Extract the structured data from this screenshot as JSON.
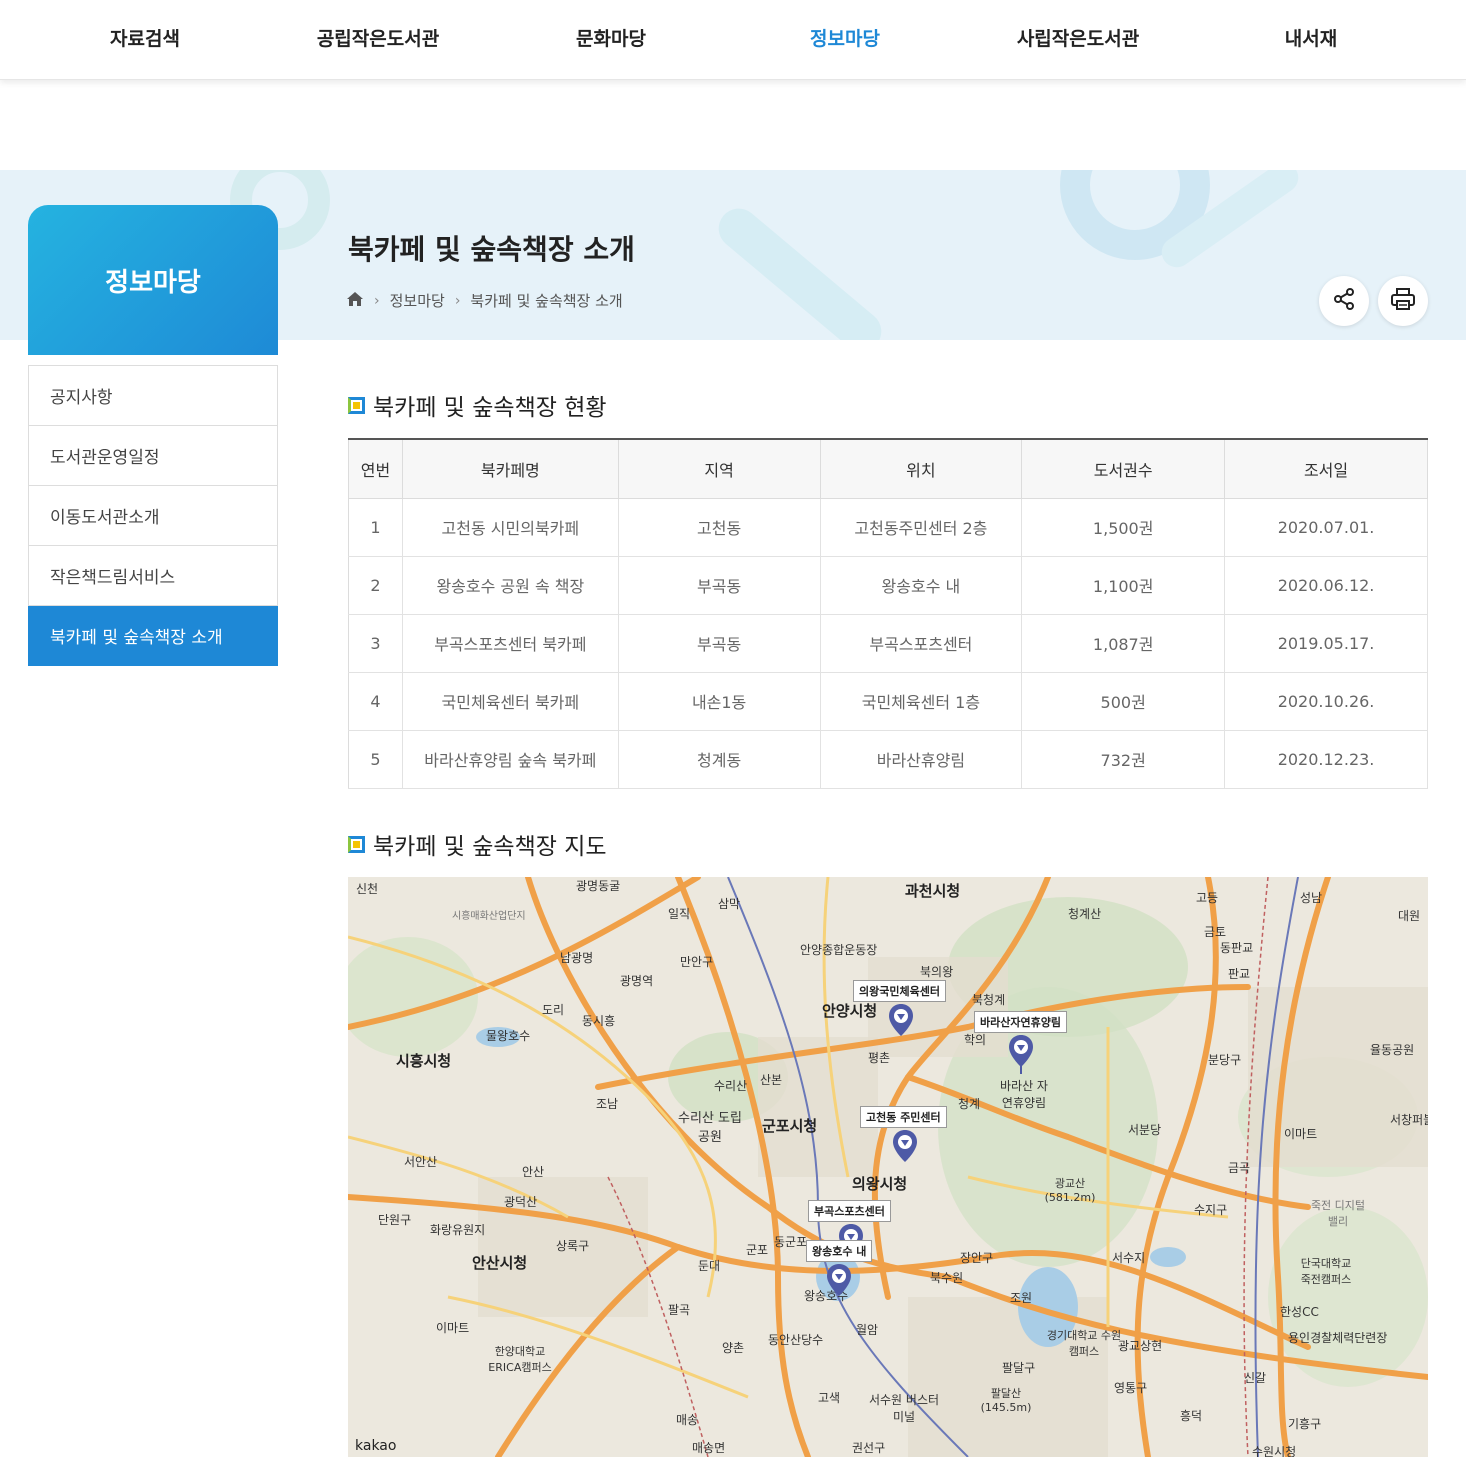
{
  "topnav": {
    "items": [
      "자료검색",
      "공립작은도서관",
      "문화마당",
      "정보마당",
      "사립작은도서관",
      "내서재"
    ],
    "active_label": "정보마당"
  },
  "sidebar": {
    "title": "정보마당",
    "items": [
      "공지사항",
      "도서관운영일정",
      "이동도서관소개",
      "작은책드림서비스",
      "북카페 및 숲속책장 소개"
    ],
    "active_label": "북카페 및 숲속책장 소개"
  },
  "header": {
    "title": "북카페 및 숲속책장 소개",
    "breadcrumb": [
      "정보마당",
      "북카페 및 숲속책장 소개"
    ],
    "share_icon": "share-icon",
    "print_icon": "print-icon"
  },
  "status_section": {
    "title": "북카페 및 숲속책장 현황",
    "columns": [
      "연번",
      "북카페명",
      "지역",
      "위치",
      "도서권수",
      "조서일"
    ],
    "rows": [
      [
        "1",
        "고천동 시민의북카페",
        "고천동",
        "고천동주민센터 2층",
        "1,500권",
        "2020.07.01."
      ],
      [
        "2",
        "왕송호수 공원 속 책장",
        "부곡동",
        "왕송호수 내",
        "1,100권",
        "2020.06.12."
      ],
      [
        "3",
        "부곡스포츠센터 북카페",
        "부곡동",
        "부곡스포츠센터",
        "1,087권",
        "2019.05.17."
      ],
      [
        "4",
        "국민체육센터 북카페",
        "내손1동",
        "국민체육센터 1층",
        "500권",
        "2020.10.26."
      ],
      [
        "5",
        "바라산휴양림 숲속 북카페",
        "청계동",
        "바라산휴양림",
        "732권",
        "2020.12.23."
      ]
    ]
  },
  "map_section": {
    "title": "북카페 및 숲속책장 지도",
    "markers": [
      "의왕국민체육센터",
      "바라산자연휴양림",
      "고천동 주민센터",
      "부곡스포츠센터",
      "왕송호수 내"
    ],
    "city_labels": [
      "과천시청",
      "안양시청",
      "시흥시청",
      "군포시청",
      "의왕시청",
      "안산시청"
    ],
    "place_labels": [
      "신천",
      "광명동굴",
      "일직",
      "삼막",
      "청계산",
      "고등",
      "성남",
      "대원",
      "시흥매화산업단지",
      "남광명",
      "광명역",
      "만안구",
      "안양종합운동장",
      "북의왕",
      "북청계",
      "금토",
      "동판교",
      "판교",
      "물왕호수",
      "도리",
      "동시흥",
      "학의",
      "바라산 자연휴양림",
      "분당구",
      "율동공원",
      "수리산",
      "산본",
      "평촌",
      "청계",
      "조남",
      "수리산 도립공원",
      "서분당",
      "이마트",
      "서창퍼블",
      "서안산",
      "안산",
      "광교산 (581.2m)",
      "금곡",
      "광덕산",
      "단원구",
      "화랑유원지",
      "상록구",
      "군포",
      "둔대",
      "동군포",
      "장안구",
      "수지구",
      "북수원",
      "죽전 디지털밸리",
      "서수지",
      "단국대학교 죽전캠퍼스",
      "조원",
      "한성CC",
      "경기대학교 수원캠퍼스",
      "광교상현",
      "용인경찰체력단련장",
      "팔곡",
      "왕송호수",
      "월암",
      "이마트",
      "한양대학교 ERICA캠퍼스",
      "양촌",
      "동안산당수",
      "팔달구",
      "신갈",
      "영통구",
      "흥덕",
      "팔달산 (145.5m)",
      "매송",
      "고색",
      "서수원 버스터미널",
      "기흥구",
      "매송면",
      "권선구",
      "수원시청"
    ],
    "brand": "kakao"
  }
}
